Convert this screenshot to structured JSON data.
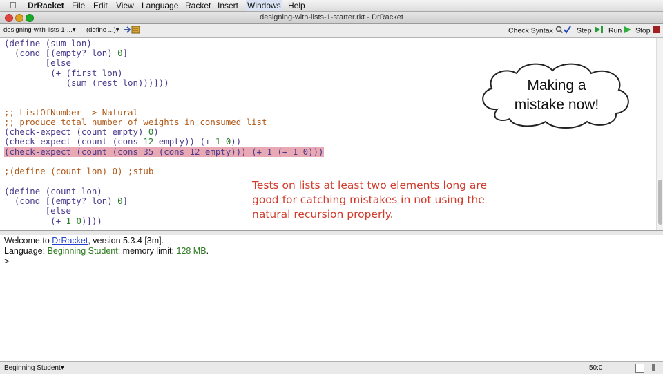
{
  "menubar": {
    "app": "DrRacket",
    "items": [
      "File",
      "Edit",
      "View",
      "Language",
      "Racket",
      "Insert",
      "Windows",
      "Help"
    ]
  },
  "window": {
    "title": "designing-with-lists-1-starter.rkt - DrRacket"
  },
  "toolbar": {
    "file_dropdown": "designing-with-lists-1-...",
    "define_dropdown": "(define ...)",
    "check_syntax": "Check Syntax",
    "step": "Step",
    "run": "Run",
    "stop": "Stop"
  },
  "editor": {
    "lines": {
      "l1": "(define (sum lon)",
      "l2a": "  (cond [(empty? lon) ",
      "l2b": "0",
      "l2c": "]",
      "l3": "        [else",
      "l4": "         (+ (first lon)",
      "l5": "            (sum (rest lon)))]))",
      "l6": ";; ListOfNumber -> Natural",
      "l7": ";; produce total number of weights in consumed list",
      "l8a": "(check-expect (count empty) ",
      "l8b": "0",
      "l8c": ")",
      "l9a": "(check-expect (count (cons ",
      "l9b": "12",
      "l9c": " empty)) (+ ",
      "l9d": "1",
      "l9e": " ",
      "l9f": "0",
      "l9g": "))",
      "l10": "(check-expect (count (cons 35 (cons 12 empty))) (+ 1 (+ 1 0)))",
      "l11": ";(define (count lon) 0) ;stub",
      "l12": "(define (count lon)",
      "l13a": "  (cond [(empty? lon) ",
      "l13b": "0",
      "l13c": "]",
      "l14": "        [else",
      "l15a": "         (+ ",
      "l15b": "1",
      "l15c": " ",
      "l15d": "0",
      "l15e": ")]))"
    }
  },
  "annotation": {
    "line1": "Tests on lists at least two elements long are",
    "line2": "good for catching mistakes in not using the",
    "line3": "natural recursion properly."
  },
  "cloud": {
    "line1": "Making a",
    "line2": "mistake now!"
  },
  "interactions": {
    "welcome_prefix": "Welcome to ",
    "welcome_link": "DrRacket",
    "welcome_suffix": ", version 5.3.4 [3m].",
    "language_prefix": "Language: ",
    "language_name": "Beginning Student",
    "language_mid": "; memory limit: ",
    "memory": "128 MB",
    "language_suffix": ".",
    "prompt": ">"
  },
  "status": {
    "language": "Beginning Student",
    "position": "50:0"
  },
  "colors": {
    "annotation": "#d23a2a",
    "highlight": "#e8a8b4",
    "link": "#2241c8"
  },
  "icons": [
    "apple-logo-icon",
    "close-window-icon",
    "minimize-window-icon",
    "zoom-window-icon",
    "chevron-down-icon",
    "check-syntax-icon",
    "step-icon",
    "run-icon",
    "stop-icon"
  ]
}
